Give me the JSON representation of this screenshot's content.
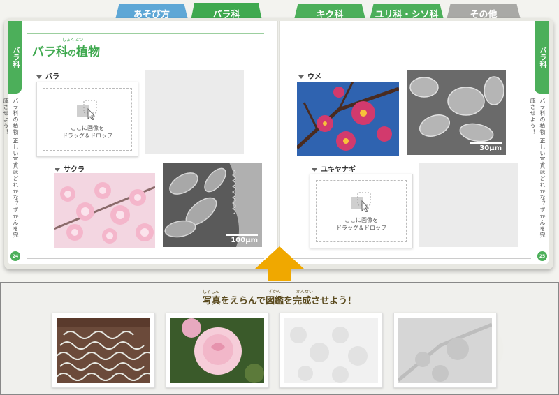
{
  "tabs": [
    {
      "label": "あそび方",
      "style": "blue"
    },
    {
      "label": "バラ科",
      "style": "green",
      "active": true
    },
    {
      "label": "キク科",
      "style": "green"
    },
    {
      "label": "ユリ科・シソ科",
      "style": "green"
    },
    {
      "label": "その他",
      "style": "gray"
    }
  ],
  "left_page": {
    "side_tab": "バラ科",
    "side_text": "バラ科の植物 正しい写真はどれかな？ずかんを完成させよう！",
    "title_main": "バラ科",
    "title_no": "の",
    "title_rest": "植物",
    "title_ruby": "しょくぶつ",
    "page_number": "24",
    "sections": [
      {
        "label": "バラ"
      },
      {
        "label": "サクラ",
        "sem_scale": "100μm"
      }
    ],
    "dropzone": {
      "line1": "ここに画像を",
      "line2": "ドラッグ＆ドロップ"
    }
  },
  "right_page": {
    "side_tab": "バラ科",
    "side_text": "バラ科の植物 正しい写真はどれかな？ずかんを完成させよう！",
    "page_number": "25",
    "sections": [
      {
        "label": "ウメ",
        "sem_scale": "30μm"
      },
      {
        "label": "ユキヤナギ"
      }
    ],
    "dropzone": {
      "line1": "ここに画像を",
      "line2": "ドラッグ＆ドロップ"
    }
  },
  "tray": {
    "title": "写真をえらんで図鑑を完成させよう！",
    "ruby_shashin": "しゃしん",
    "ruby_zukan": "ずかん",
    "ruby_kansei": "かんせい",
    "cards": [
      {
        "name": "lichen-photo",
        "state": "available"
      },
      {
        "name": "rose-photo",
        "state": "available"
      },
      {
        "name": "cherry-photo-used",
        "state": "used"
      },
      {
        "name": "plum-photo-used",
        "state": "used"
      }
    ]
  },
  "colors": {
    "green": "#4caf5a",
    "blue": "#5ea7d6",
    "gray": "#a9a9a6",
    "arrow": "#f0a800"
  }
}
